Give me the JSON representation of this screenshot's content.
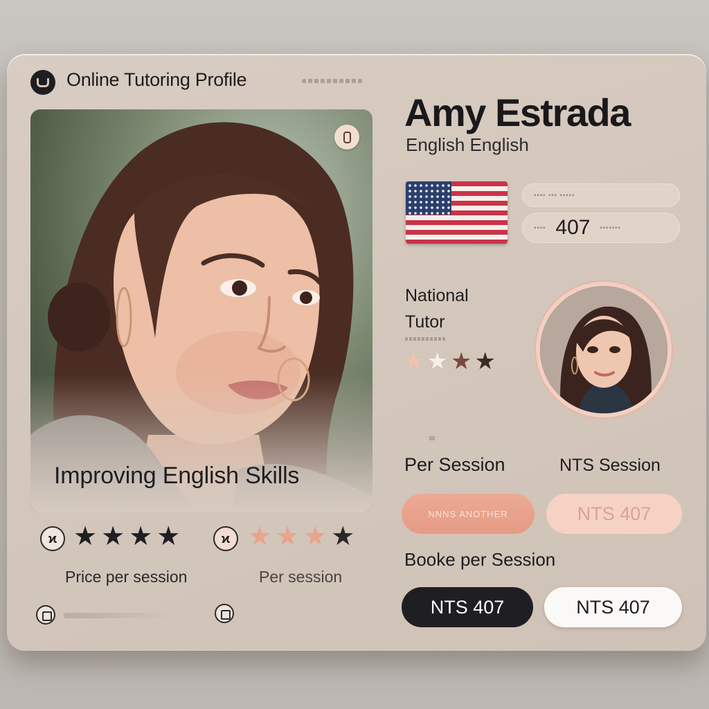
{
  "header": {
    "title": "Online Tutoring Profile"
  },
  "profile": {
    "name": "Amy Estrada",
    "language_line": "English English",
    "role_line1": "National",
    "role_line2": "Tutor",
    "tagline": "Improving English Skills",
    "price_field_value": "407"
  },
  "left_ratings": [
    {
      "stars_filled": 4,
      "stars_total": 4,
      "star_color": "#1f1f22",
      "label": "Price per session"
    },
    {
      "stars_filled": 3,
      "stars_total": 4,
      "star_color": "#e8a48c",
      "label": "Per session"
    }
  ],
  "right_rating": {
    "stars": [
      "#f0c4b0",
      "#f6efe9",
      "#7a4a3c",
      "#3a2a26"
    ]
  },
  "pricing": {
    "per_session_label": "Per Session",
    "nts_session_label": "NTS Session",
    "peach_button_text": "NNNS ANOTHER",
    "blush_button_text": "NTS 407",
    "booked_label": "Booke per Session",
    "dark_button_text": "NTS 407",
    "light_button_text": "NTS 407"
  },
  "colors": {
    "card_bg": "#d6c9be",
    "accent_peach": "#e8a48c",
    "dark": "#1f1f22"
  },
  "icons": [
    "brand-logo-icon",
    "photo-badge-icon",
    "rating-icon",
    "small-square-icon"
  ]
}
